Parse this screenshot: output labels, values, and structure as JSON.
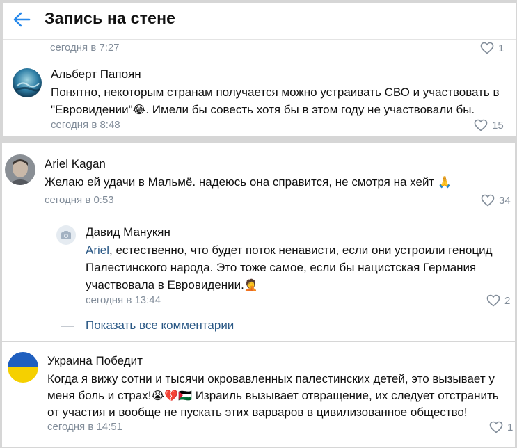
{
  "header": {
    "title": "Запись на стене"
  },
  "comments": [
    {
      "timestamp": "сегодня в 7:27",
      "likes": "1"
    },
    {
      "author": "Альберт Папоян",
      "text_1": "Понятно, некоторым странам получается можно устраивать СВО и участвовать в",
      "text_2a": "\"Евровидении\"",
      "text_2_emoji": "😂",
      "text_2b": ". Имели бы совесть хотя бы в этом году не участвовали бы.",
      "timestamp": "сегодня в 8:48",
      "likes": "15"
    },
    {
      "author": "Ariel Kagan",
      "text_1": "Желаю ей удачи в Мальмё. надеюсь она справится, не смотря на хейт",
      "text_1_emoji": "🙏",
      "timestamp": "сегодня в 0:53",
      "likes": "34"
    }
  ],
  "reply": {
    "author": "Давид Манукян",
    "mention": "Ariel",
    "text_1": ", естественно, что будет поток ненависти, если они устроили геноцид",
    "text_2": "Палестинского народа. Это тоже самое, если бы нацистская Германия",
    "text_3": "участвовала в Евровидении.",
    "text_3_emoji": "🤦",
    "timestamp": "сегодня в 13:44",
    "likes": "2"
  },
  "show_all_comments": "Показать все комментарии",
  "last_comment": {
    "author": "Украина Победит",
    "text_1": "Когда я вижу сотни и тысячи окровавленных палестинских детей, это вызывает у",
    "text_2a": "меня боль и страх!",
    "text_2_emoji": "😭💔🇵🇸",
    "text_2b": " Израиль вызывает отвращение, их следует отстранить",
    "text_3": "от участия и вообще не пускать этих варваров в цивилизованное общество!",
    "timestamp": "сегодня в 14:51",
    "likes": "1"
  },
  "colors": {
    "accent": "#2a5885",
    "back_arrow": "#2688eb",
    "meta": "#818c99",
    "flag_blue": "#1f5fbf",
    "flag_yellow": "#f5d000"
  },
  "icons": [
    "back-arrow-icon",
    "heart-icon",
    "camera-icon"
  ]
}
